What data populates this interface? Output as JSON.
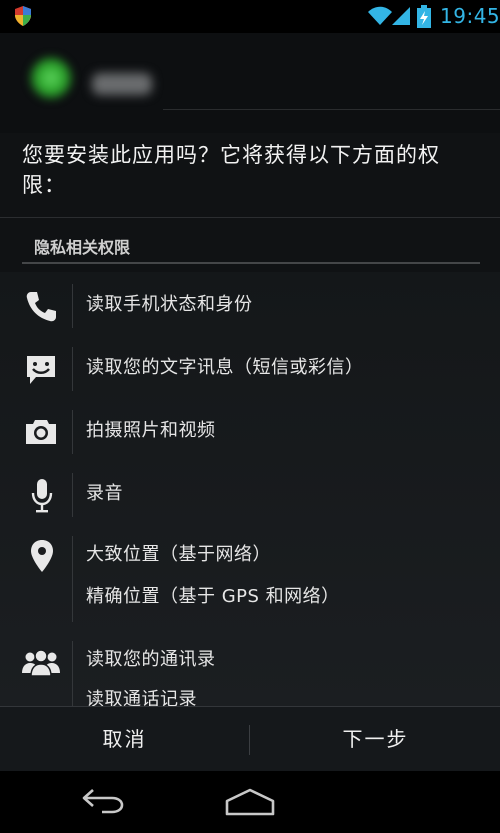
{
  "status_bar": {
    "time": "19:45",
    "icons": [
      "shield-icon",
      "wifi-icon",
      "signal-icon",
      "battery-charging-icon"
    ],
    "accent": "#33b5e5"
  },
  "install": {
    "question": "您要安装此应用吗？它将获得以下方面的权限："
  },
  "section": {
    "title": "隐私相关权限"
  },
  "permissions": [
    {
      "icon": "phone-icon",
      "labels": [
        "读取手机状态和身份"
      ]
    },
    {
      "icon": "message-icon",
      "labels": [
        "读取您的文字讯息（短信或彩信）"
      ]
    },
    {
      "icon": "camera-icon",
      "labels": [
        "拍摄照片和视频"
      ]
    },
    {
      "icon": "microphone-icon",
      "labels": [
        "录音"
      ]
    },
    {
      "icon": "location-pin-icon",
      "labels": [
        "大致位置（基于网络）",
        "精确位置（基于 GPS 和网络）"
      ]
    },
    {
      "icon": "contacts-icon",
      "labels": [
        "读取您的通讯录",
        "读取通话记录"
      ]
    }
  ],
  "buttons": {
    "cancel": "取消",
    "next": "下一步"
  },
  "nav_bar": {
    "icons": [
      "back-icon",
      "home-icon"
    ]
  }
}
